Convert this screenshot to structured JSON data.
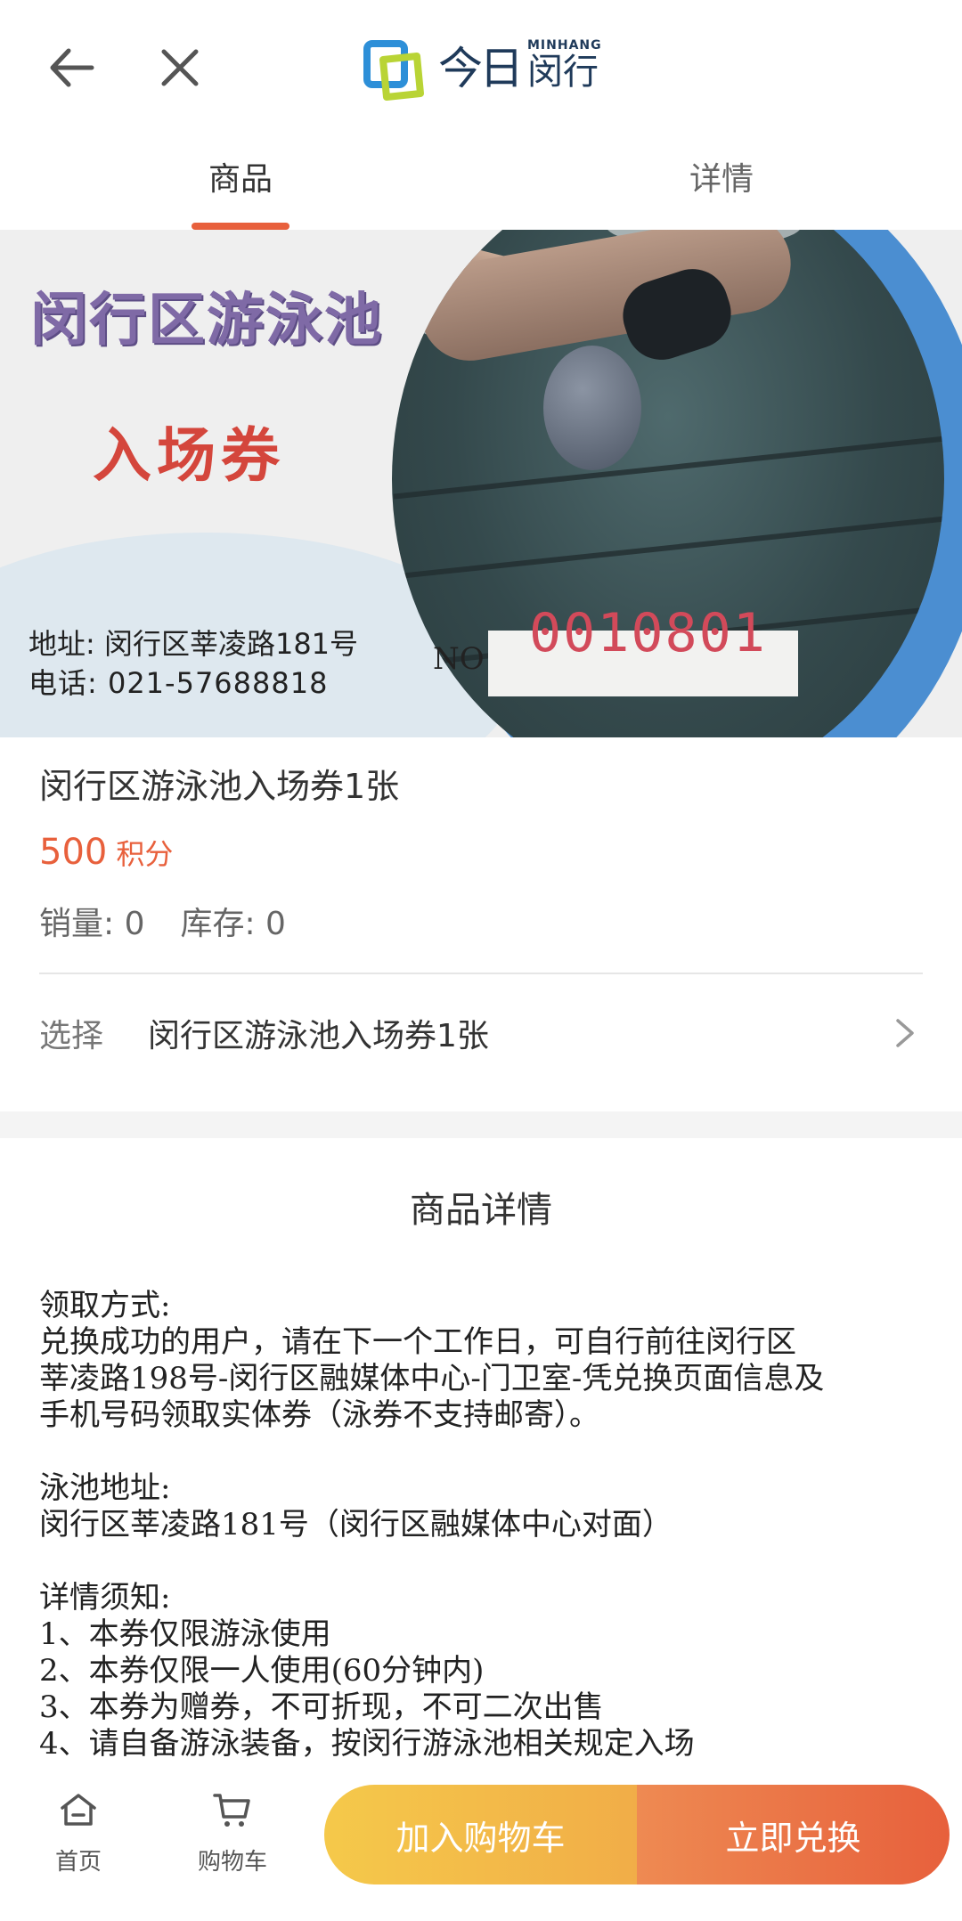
{
  "header": {
    "logo_jinri": "今日",
    "logo_en": "MINHANG",
    "logo_cn": "闵行"
  },
  "tabs": [
    {
      "label": "商品",
      "active": true
    },
    {
      "label": "详情",
      "active": false
    }
  ],
  "banner": {
    "title": "闵行区游泳池",
    "subtitle": "入场券",
    "address": "地址: 闵行区莘凌路181号",
    "phone": "电话: 021-57688818",
    "no_label": "NO",
    "no_value": "0010801"
  },
  "product": {
    "name": "闵行区游泳池入场券1张",
    "price": "500",
    "price_unit": "积分",
    "sales": "销量: 0",
    "stock": "库存: 0",
    "select_label": "选择",
    "select_value": "闵行区游泳池入场券1张"
  },
  "details": {
    "title": "商品详情",
    "pickup_heading": "领取方式:",
    "pickup_lines": [
      "兑换成功的用户，请在下一个工作日，可自行前往闵行区",
      "莘凌路198号-闵行区融媒体中心-门卫室-凭兑换页面信息及",
      "手机号码领取实体券（泳券不支持邮寄）。"
    ],
    "pool_heading": "泳池地址:",
    "pool_address": "闵行区莘凌路181号（闵行区融媒体中心对面）",
    "notice_heading": "详情须知:",
    "notice_lines": [
      "1、本券仅限游泳使用",
      "2、本券仅限一人使用(60分钟内)",
      "3、本券为赠券，不可折现，不可二次出售",
      "4、请自备游泳装备，按闵行游泳池相关规定入场"
    ]
  },
  "bottom": {
    "home_label": "首页",
    "cart_label": "购物车",
    "add_cart": "加入购物车",
    "buy_now": "立即兑换"
  },
  "colors": {
    "accent": "#e8603c",
    "cart_button": "#f5c94a",
    "buy_button": "#e7603c"
  },
  "icons": [
    "back-arrow-icon",
    "close-icon",
    "chevron-right-icon",
    "home-icon",
    "cart-icon"
  ]
}
